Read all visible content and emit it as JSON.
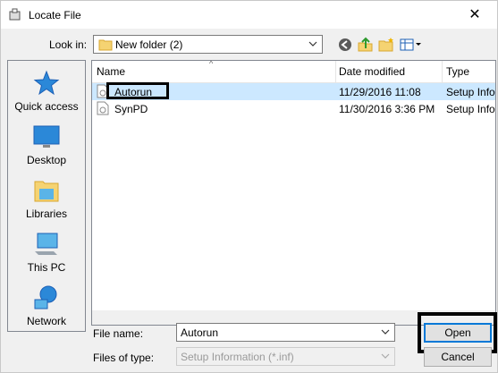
{
  "window": {
    "title": "Locate File",
    "close_glyph": "✕"
  },
  "lookin": {
    "label": "Look in:",
    "value": "New folder (2)"
  },
  "toolbar": {
    "icons": [
      "back-icon",
      "up-folder-icon",
      "new-folder-icon",
      "view-menu-icon"
    ]
  },
  "places": [
    {
      "label": "Quick access",
      "icon": "star-icon"
    },
    {
      "label": "Desktop",
      "icon": "desktop-icon"
    },
    {
      "label": "Libraries",
      "icon": "libraries-icon"
    },
    {
      "label": "This PC",
      "icon": "computer-icon"
    },
    {
      "label": "Network",
      "icon": "network-icon"
    }
  ],
  "columns": [
    "Name",
    "Date modified",
    "Type"
  ],
  "files": [
    {
      "name": "Autorun",
      "date": "11/29/2016 11:08",
      "type": "Setup Infor"
    },
    {
      "name": "SynPD",
      "date": "11/30/2016 3:36 PM",
      "type": "Setup Infor"
    }
  ],
  "filename": {
    "label": "File name:",
    "value": "Autorun"
  },
  "filetype": {
    "label": "Files of type:",
    "value": "Setup Information (*.inf)"
  },
  "buttons": {
    "open": "Open",
    "cancel": "Cancel"
  },
  "colors": {
    "selection": "#cce8ff",
    "accent": "#0078d7"
  }
}
